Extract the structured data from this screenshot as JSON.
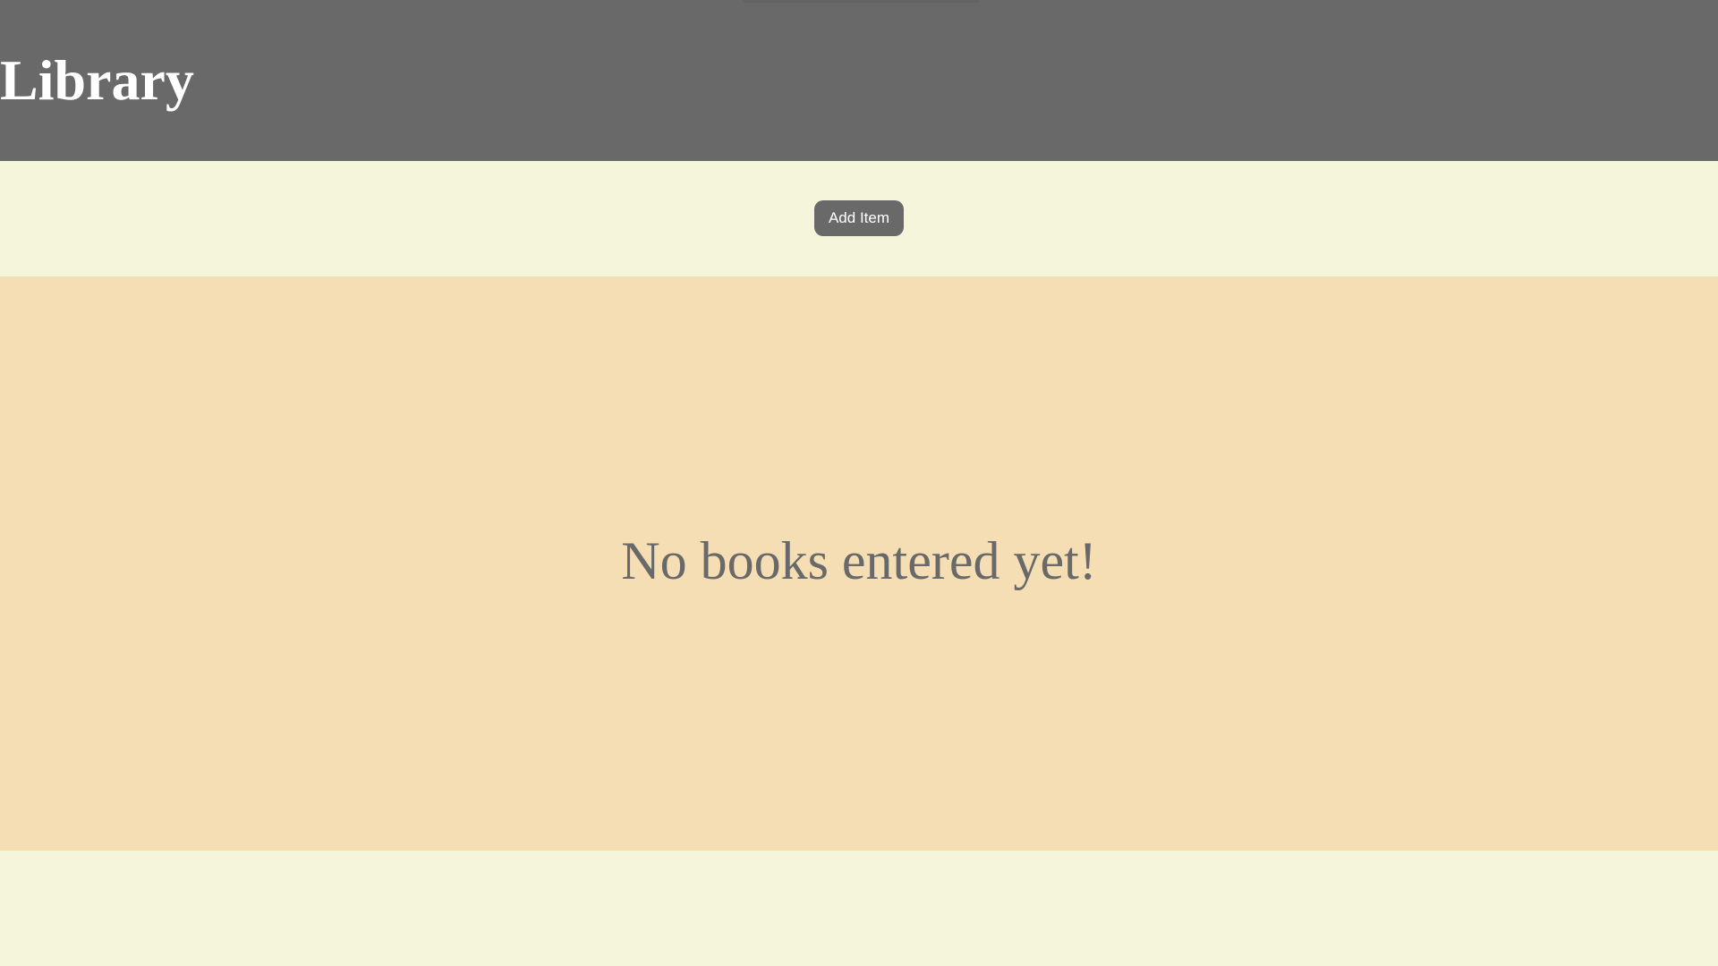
{
  "header": {
    "title": "Library"
  },
  "toolbar": {
    "add_button_label": "Add Item"
  },
  "library": {
    "empty_message": "No books entered yet!"
  },
  "colors": {
    "header_background": "#696969",
    "page_background": "#f5f5dc",
    "panel_background": "#f5deb3",
    "text_accent": "#696969"
  }
}
